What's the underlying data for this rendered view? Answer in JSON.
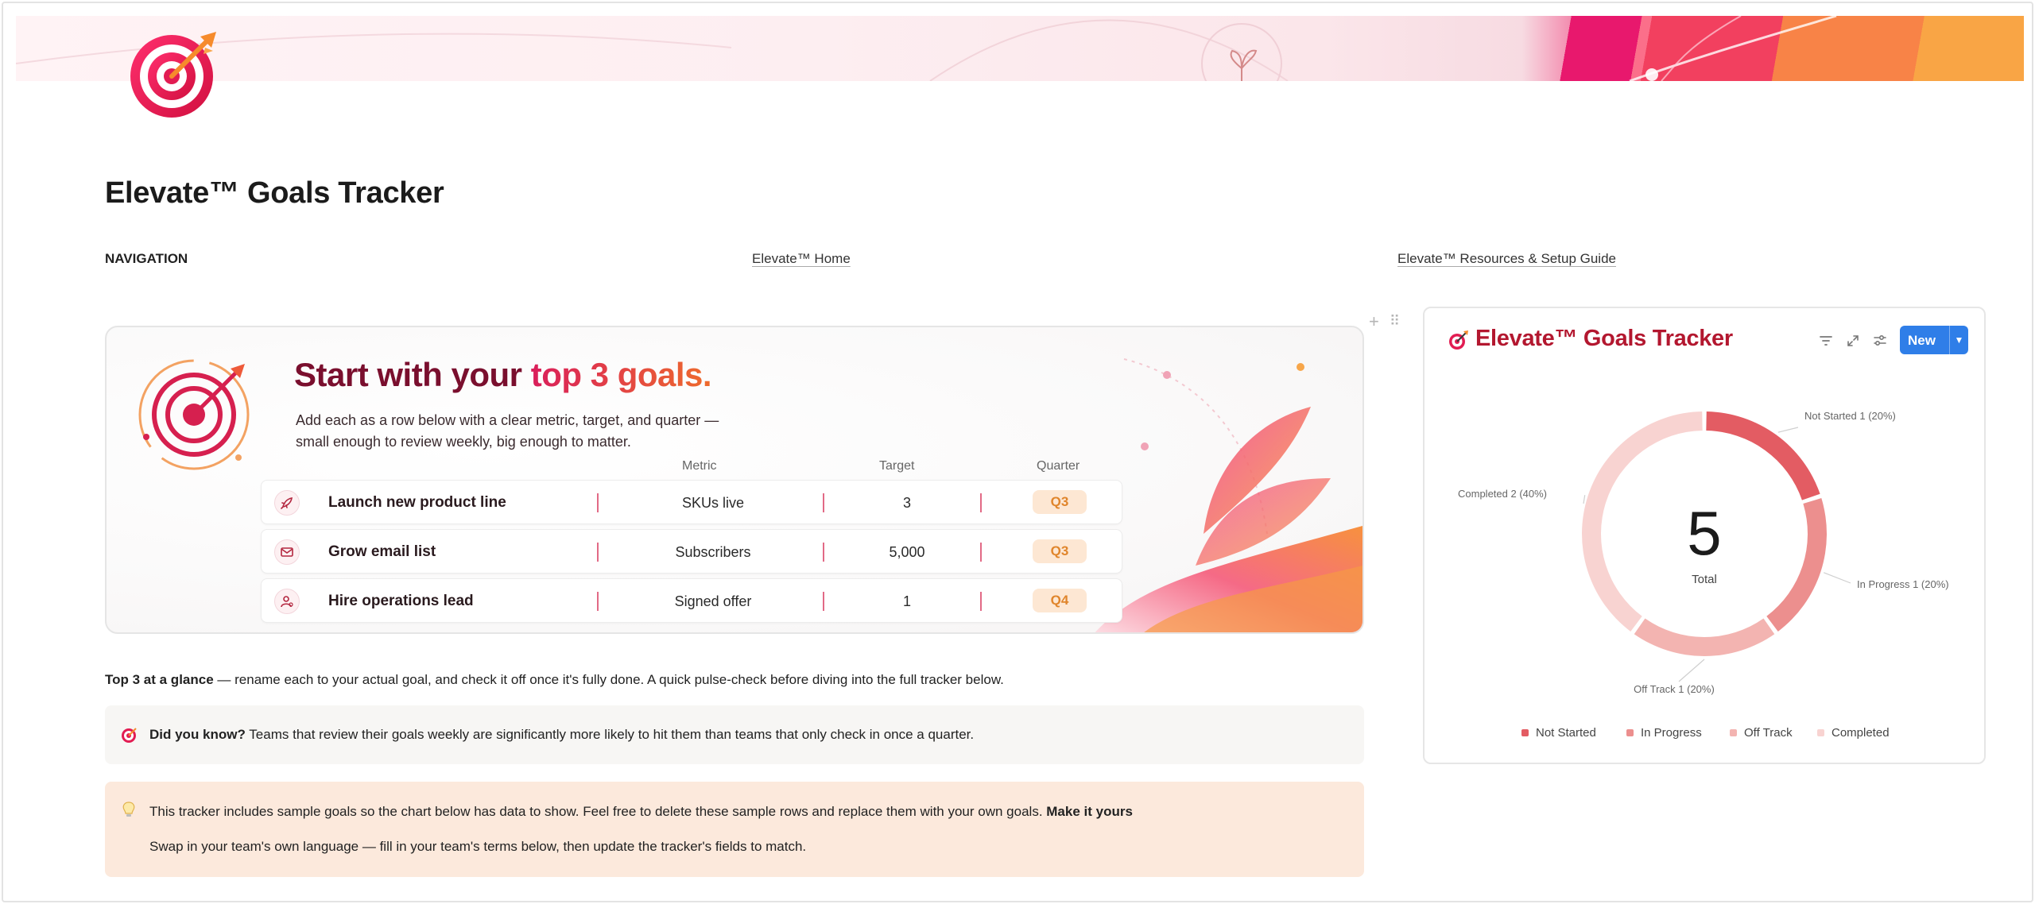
{
  "page": {
    "title": "Elevate™ Goals Tracker"
  },
  "navigation": {
    "label": "NAVIGATION",
    "links": [
      "Elevate™ Home",
      "Elevate™ Resources & Setup Guide"
    ]
  },
  "hero": {
    "heading_start": "Start with your ",
    "heading_accent": "top 3 goals.",
    "subtitle_line1": "Add each as a row below with a clear metric, target, and quarter —",
    "subtitle_line2": "small enough to review weekly, big enough to matter.",
    "columns": [
      "Metric",
      "Target",
      "Quarter"
    ],
    "goals": [
      {
        "icon": "rocket-icon",
        "name": "Launch new product line",
        "metric": "SKUs live",
        "target": "3",
        "quarter": "Q3"
      },
      {
        "icon": "mail-icon",
        "name": "Grow email list",
        "metric": "Subscribers",
        "target": "5,000",
        "quarter": "Q3"
      },
      {
        "icon": "person-icon",
        "name": "Hire operations lead",
        "metric": "Signed offer",
        "target": "1",
        "quarter": "Q4"
      }
    ]
  },
  "glance": {
    "bold": "Top 3 at a glance",
    "text": " — rename each to your actual goal, and check it off once it's fully done. A quick pulse-check before diving into the full tracker below."
  },
  "callout_did_you_know": {
    "bold": "Did you know?",
    "text": " Teams that review their goals weekly are significantly more likely to hit them than teams that only check in once a quarter."
  },
  "callout_sample": {
    "icon": "lightbulb-icon",
    "line1": "This tracker includes sample goals so the chart below has data to show. Feel free to delete these sample rows and replace them with your own goals. ",
    "line1_bold": "Make it yours",
    "line2": "Swap in your team's own language — fill in your team's terms below, then update the tracker's fields to match."
  },
  "widget": {
    "title": "Elevate™ Goals Tracker",
    "new_button": "New",
    "tools": [
      "filter-icon",
      "expand-icon",
      "settings-icon"
    ]
  },
  "chart_data": {
    "type": "pie",
    "variant": "donut",
    "center_value": "5",
    "center_label": "Total",
    "categories": [
      "Not Started",
      "In Progress",
      "Off Track",
      "Completed"
    ],
    "values": [
      1,
      1,
      1,
      2
    ],
    "labels": [
      "Not Started  1 (20%)",
      "In Progress  1 (20%)",
      "Off Track  1 (20%)",
      "Completed  2 (40%)"
    ],
    "colors": [
      "#e35c63",
      "#ec8f8e",
      "#f3b4b1",
      "#f8d3d1"
    ],
    "legend": "bottom"
  }
}
